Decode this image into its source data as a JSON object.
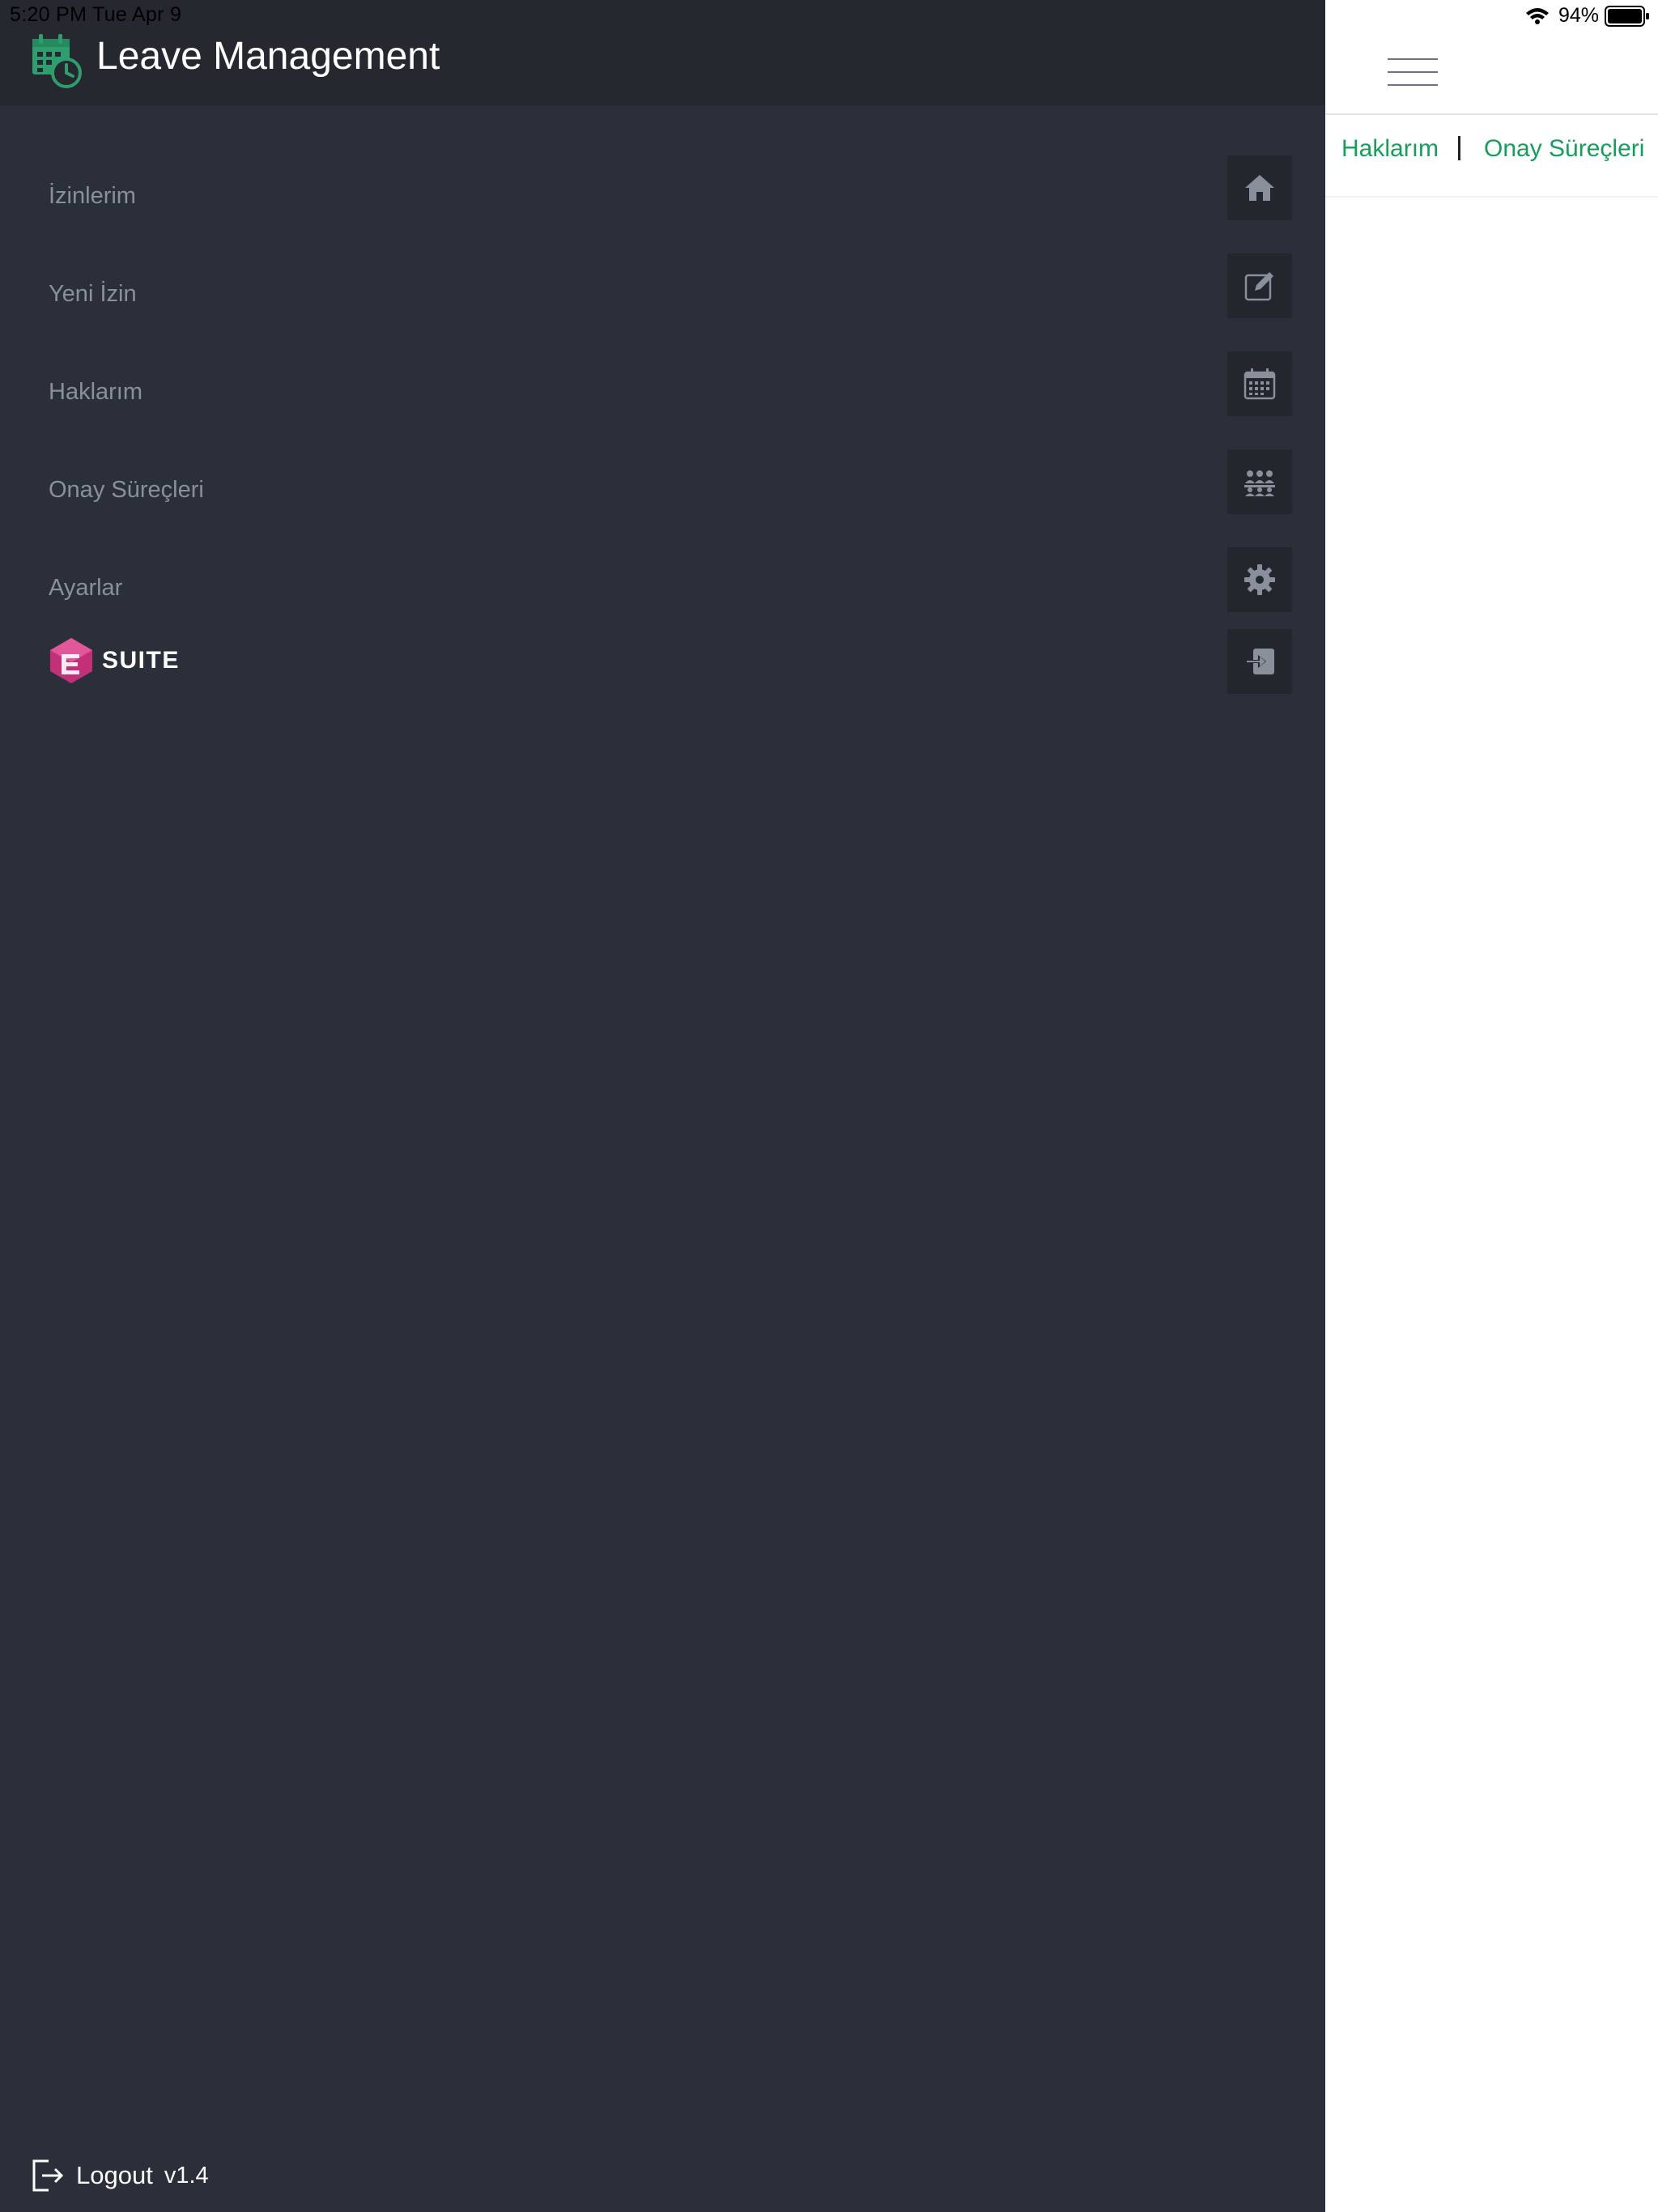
{
  "status_bar": {
    "time": "5:20 PM  Tue Apr 9",
    "battery": "94%"
  },
  "app": {
    "title": "Leave Management",
    "logo_icon": "calendar-clock-icon"
  },
  "menu": {
    "items": [
      {
        "label": "İzinlerim",
        "icon": "home-icon"
      },
      {
        "label": "Yeni İzin",
        "icon": "edit-icon"
      },
      {
        "label": "Haklarım",
        "icon": "calendar-icon"
      },
      {
        "label": "Onay Süreçleri",
        "icon": "team-icon"
      },
      {
        "label": "Ayarlar",
        "icon": "gear-icon"
      }
    ],
    "suite": {
      "label": "SUITE",
      "icon": "login-icon"
    }
  },
  "footer": {
    "logout_label": "Logout",
    "version": "v1.4"
  },
  "content": {
    "tabs": [
      {
        "label": "Haklarım"
      },
      {
        "label": "Onay Süreçleri"
      }
    ]
  },
  "colors": {
    "sidebar_bg": "#2b2f3a",
    "header_bg": "#25282f",
    "accent_green": "#14a05a",
    "menu_text": "#8a8f9c"
  }
}
